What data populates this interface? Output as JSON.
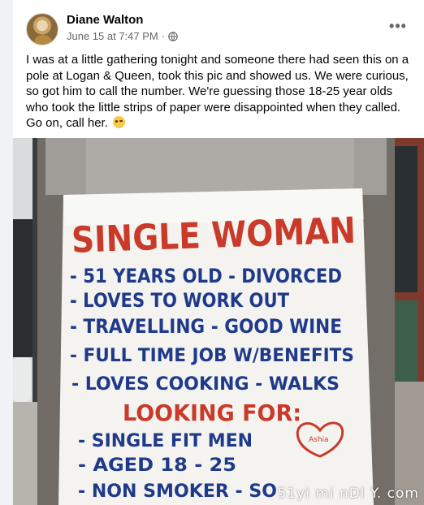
{
  "post": {
    "author": "Diane Walton",
    "timestamp": "June 15 at 7:47 PM",
    "separator": "·",
    "audience_icon": "globe-icon",
    "more_icon": "more-horizontal-icon",
    "text": "I was at a little gathering tonight and someone there had seen this on a pole at Logan & Queen, took this pic and showed us. We were curious, so got him to call the number. We're guessing those 18-25 year olds who took the little strips of paper were disappointed when they called. Go on, call her.",
    "emoji": "winking-face-emoji"
  },
  "sign": {
    "headline": "SINGLE WOMAN",
    "lines": [
      "- 51 YEARS OLD - DIVORCED",
      "- LOVES TO WORK OUT",
      "- TRAVELLING - GOOD WINE",
      "- FULL TIME JOB W/BENEFITS",
      "- LOVES COOKING - WALKS"
    ],
    "looking_for": "LOOKING FOR:",
    "wants": [
      "- SINGLE FIT MEN",
      "- AGED 18 - 25",
      "- NON SMOKER - SO"
    ],
    "heart_text": "Ashia"
  },
  "watermark": "51yi mi nDl Y. com",
  "colors": {
    "name": "#050505",
    "meta": "#65676b",
    "sign_red": "#c93a2a",
    "sign_blue": "#1f3a8a",
    "paper": "#f4f3ef",
    "pole": "#7a7570",
    "brick": "#8a3b2a"
  }
}
